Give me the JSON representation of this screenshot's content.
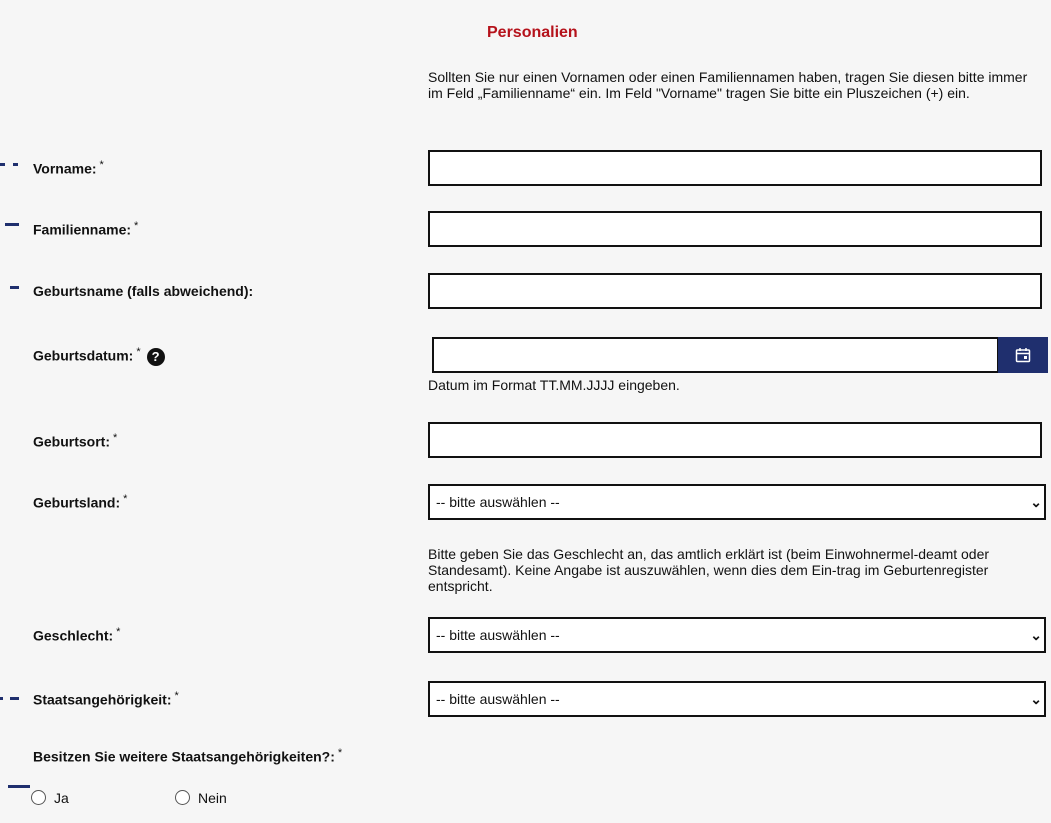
{
  "section_title": "Personalien",
  "notes": {
    "name_hint": "Sollten Sie nur einen Vornamen oder einen Familiennamen haben, tragen Sie diesen bitte immer im Feld „Familienname“ ein. Im Feld \"Vorname\" tragen Sie bitte ein Pluszeichen (+) ein.",
    "date_hint": "Datum im Format TT.MM.JJJJ eingeben.",
    "gender_hint": "Bitte geben Sie das Geschlecht an, das amtlich erklärt ist (beim Einwohnermel-deamt oder Standesamt). Keine Angabe ist auszuwählen, wenn dies dem Ein-trag im Geburtenregister entspricht."
  },
  "labels": {
    "vorname": "Vorname:",
    "familienname": "Familienname:",
    "geburtsname": "Geburtsname (falls abweichend):",
    "geburtsdatum": "Geburtsdatum:",
    "geburtsort": "Geburtsort:",
    "geburtsland": "Geburtsland:",
    "geschlecht": "Geschlecht:",
    "staatsangehoerigkeit": "Staatsangehörigkeit:",
    "weitere": "Besitzen Sie weitere Staatsangehörigkeiten?:"
  },
  "required_mark": "*",
  "help_glyph": "?",
  "selects": {
    "geburtsland": "-- bitte auswählen --",
    "geschlecht": "-- bitte auswählen --",
    "staatsangehoerigkeit": "-- bitte auswählen --"
  },
  "radio_options": [
    "Ja",
    "Nein"
  ],
  "icons": {
    "calendar": "calendar-icon",
    "help": "help-icon",
    "chevron": "chevron-down-icon"
  },
  "colors": {
    "title": "#b5121b",
    "button": "#1f2f6e"
  }
}
